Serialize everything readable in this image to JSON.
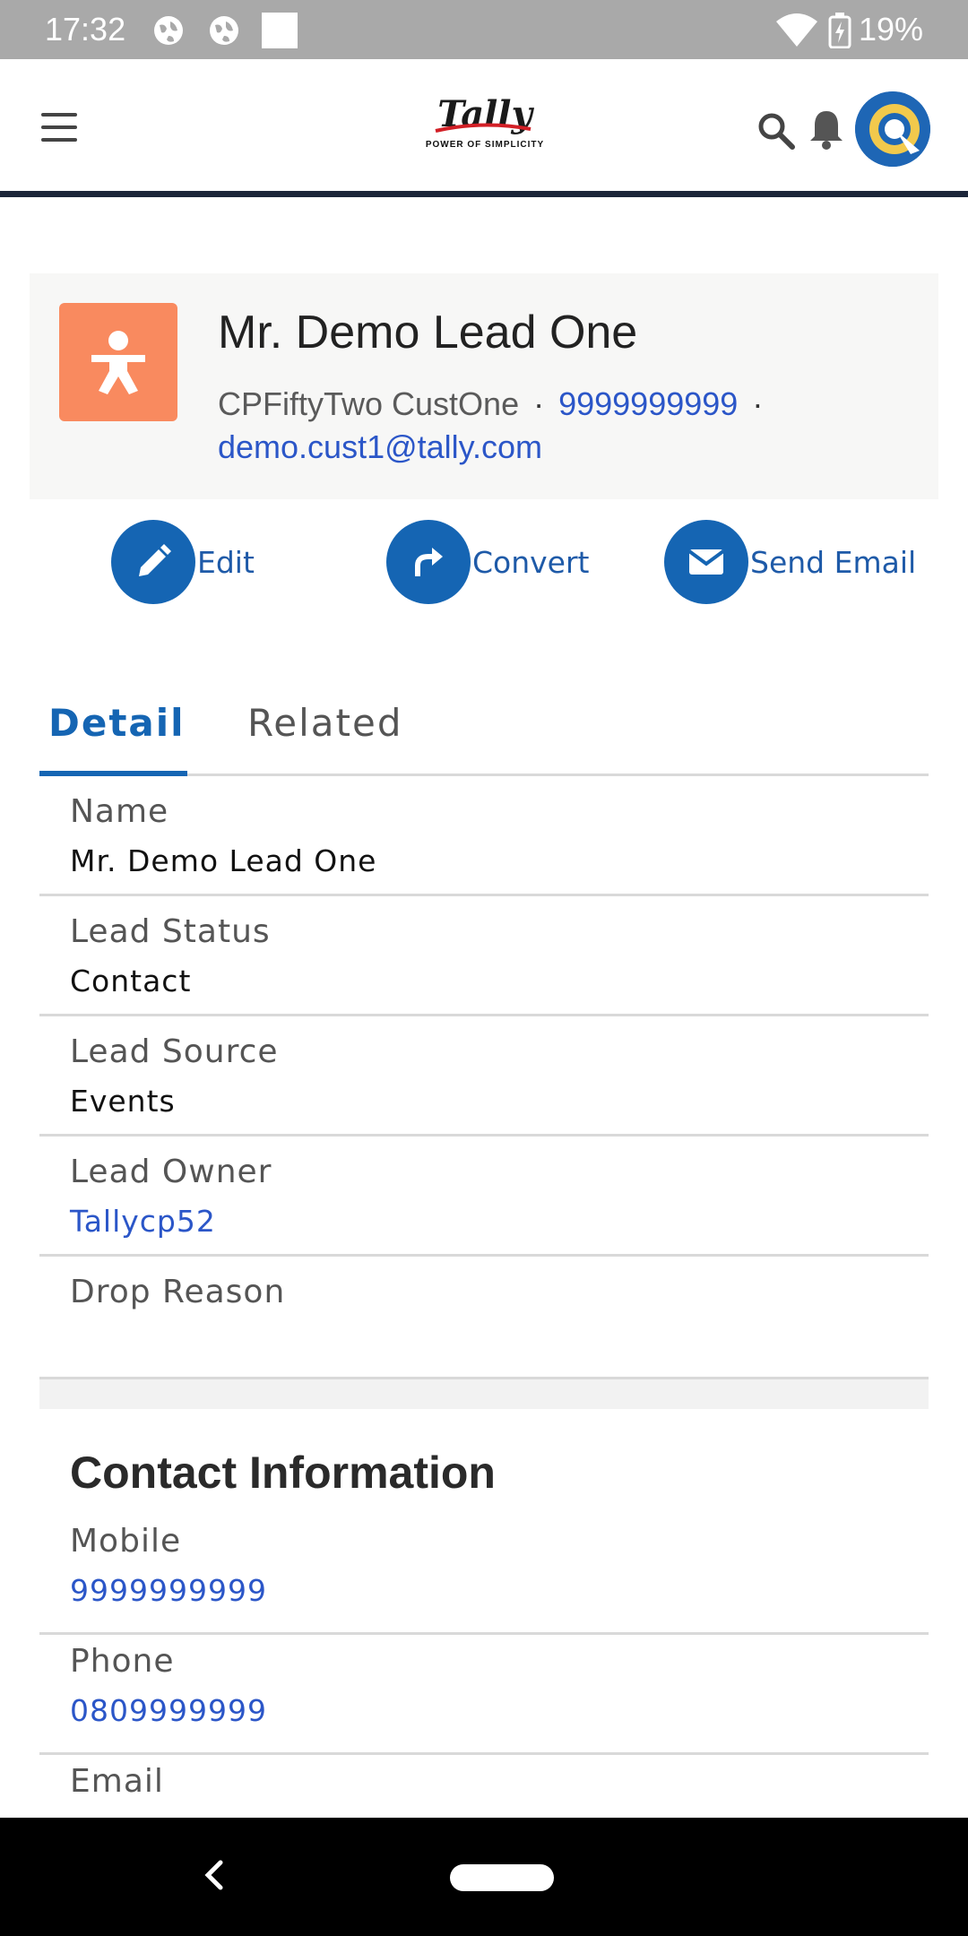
{
  "status_bar": {
    "time": "17:32",
    "battery_pct": "19%"
  },
  "header": {
    "logo_text": "Tally",
    "logo_tagline": "POWER OF SIMPLICITY"
  },
  "lead": {
    "name": "Mr. Demo Lead One",
    "company": "CPFiftyTwo CustOne",
    "phone": "9999999999",
    "email": "demo.cust1@tally.com"
  },
  "actions": [
    {
      "label": "Edit",
      "icon": "pencil-icon"
    },
    {
      "label": "Convert",
      "icon": "convert-arrow-icon"
    },
    {
      "label": "Send Email",
      "icon": "envelope-icon"
    }
  ],
  "tabs": [
    {
      "label": "Detail",
      "active": true
    },
    {
      "label": "Related",
      "active": false
    }
  ],
  "detail_fields": [
    {
      "label": "Name",
      "value": "Mr. Demo Lead One",
      "link": false
    },
    {
      "label": "Lead Status",
      "value": "Contact",
      "link": false
    },
    {
      "label": "Lead Source",
      "value": "Events",
      "link": false
    },
    {
      "label": "Lead Owner",
      "value": "Tallycp52",
      "link": true
    },
    {
      "label": "Drop Reason",
      "value": "",
      "link": false
    }
  ],
  "contact_section": {
    "title": "Contact Information",
    "fields": [
      {
        "label": "Mobile",
        "value": "9999999999",
        "link": true
      },
      {
        "label": "Phone",
        "value": "0809999999",
        "link": true
      },
      {
        "label": "Email",
        "value": "",
        "link": true
      }
    ]
  },
  "colors": {
    "primary": "#1565b3",
    "link": "#2b56c8",
    "lead_avatar": "#f98a5f",
    "header_rule": "#1b2539"
  }
}
